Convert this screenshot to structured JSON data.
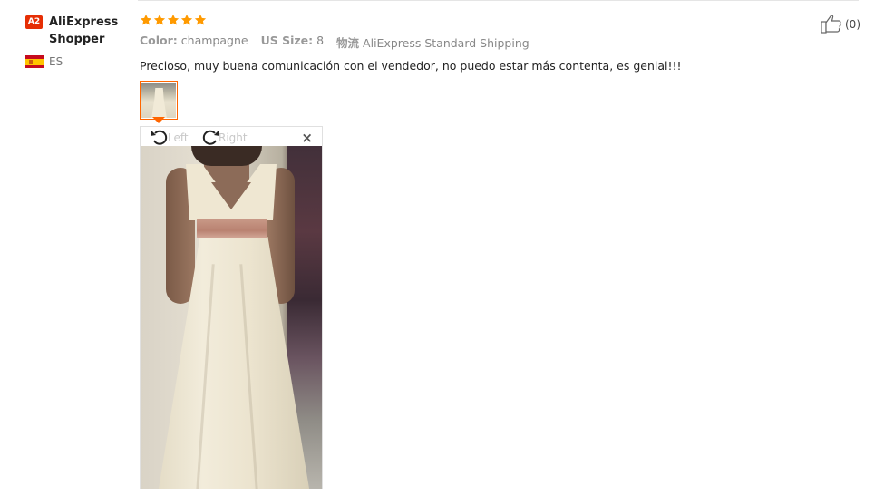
{
  "user": {
    "badge": "A2",
    "name": "AliExpress Shopper",
    "country_code": "ES"
  },
  "review": {
    "rating": 5,
    "max_rating": 5,
    "color_label": "Color:",
    "color_value": "champagne",
    "size_label": "US Size:",
    "size_value": "8",
    "shipping_label": "物流",
    "shipping_value": "AliExpress Standard Shipping",
    "comment": "Precioso, muy buena comunicación con el vendedor, no puedo estar más contenta, es genial!!!"
  },
  "viewer": {
    "rotate_left_label": "Left",
    "rotate_right_label": "Right",
    "close_symbol": "×"
  },
  "helpful": {
    "count": "(0)",
    "icon": "thumbs-up-icon"
  },
  "colors": {
    "star": "#ff9a00",
    "badge": "#e62e04",
    "thumb_border": "#ff6600"
  }
}
